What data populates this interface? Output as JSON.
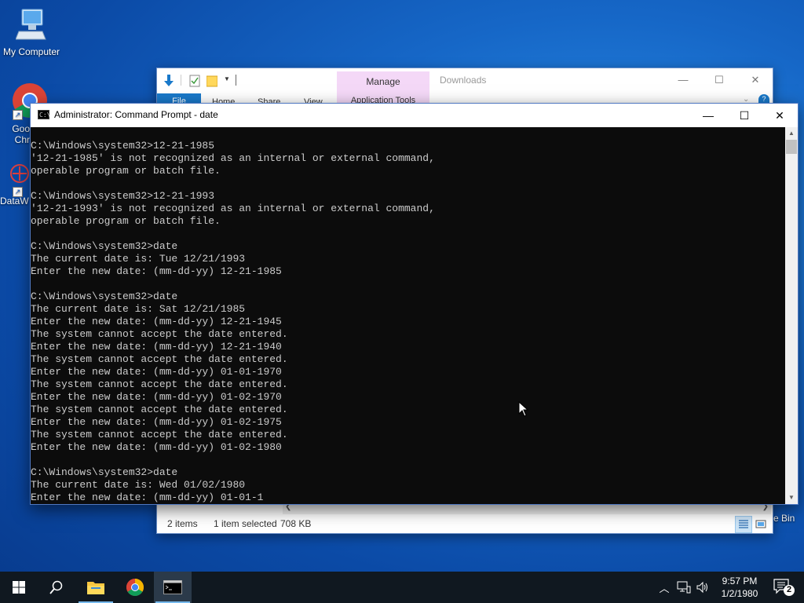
{
  "desktop": {
    "icons": [
      {
        "label": "My Computer"
      },
      {
        "label": "Goo\nChr"
      },
      {
        "label": "DataW"
      }
    ],
    "recycle_bin_partial_label": "e Bin"
  },
  "explorer": {
    "manage_tab": "Manage",
    "app_tools_tab": "Application Tools",
    "caption": "Downloads",
    "ribbon": {
      "file": "File",
      "home": "Home",
      "share": "Share",
      "view": "View"
    },
    "status": {
      "items": "2 items",
      "selected": "1 item selected",
      "size": "708 KB"
    }
  },
  "cmd": {
    "title": "Administrator: Command Prompt - date",
    "icon_text": "C:\\",
    "lines": [
      "C:\\Windows\\system32>12-21-1985",
      "'12-21-1985' is not recognized as an internal or external command,",
      "operable program or batch file.",
      "",
      "C:\\Windows\\system32>12-21-1993",
      "'12-21-1993' is not recognized as an internal or external command,",
      "operable program or batch file.",
      "",
      "C:\\Windows\\system32>date",
      "The current date is: Tue 12/21/1993",
      "Enter the new date: (mm-dd-yy) 12-21-1985",
      "",
      "C:\\Windows\\system32>date",
      "The current date is: Sat 12/21/1985",
      "Enter the new date: (mm-dd-yy) 12-21-1945",
      "The system cannot accept the date entered.",
      "Enter the new date: (mm-dd-yy) 12-21-1940",
      "The system cannot accept the date entered.",
      "Enter the new date: (mm-dd-yy) 01-01-1970",
      "The system cannot accept the date entered.",
      "Enter the new date: (mm-dd-yy) 01-02-1970",
      "The system cannot accept the date entered.",
      "Enter the new date: (mm-dd-yy) 01-02-1975",
      "The system cannot accept the date entered.",
      "Enter the new date: (mm-dd-yy) 01-02-1980",
      "",
      "C:\\Windows\\system32>date",
      "The current date is: Wed 01/02/1980",
      "Enter the new date: (mm-dd-yy) 01-01-1"
    ]
  },
  "taskbar": {
    "time": "9:57 PM",
    "date": "1/2/1980",
    "notification_count": "2"
  },
  "colors": {
    "console_bg": "#0c0c0c",
    "console_fg": "#cccccc",
    "taskbar_bg": "#101820",
    "accent": "#1979ca"
  }
}
